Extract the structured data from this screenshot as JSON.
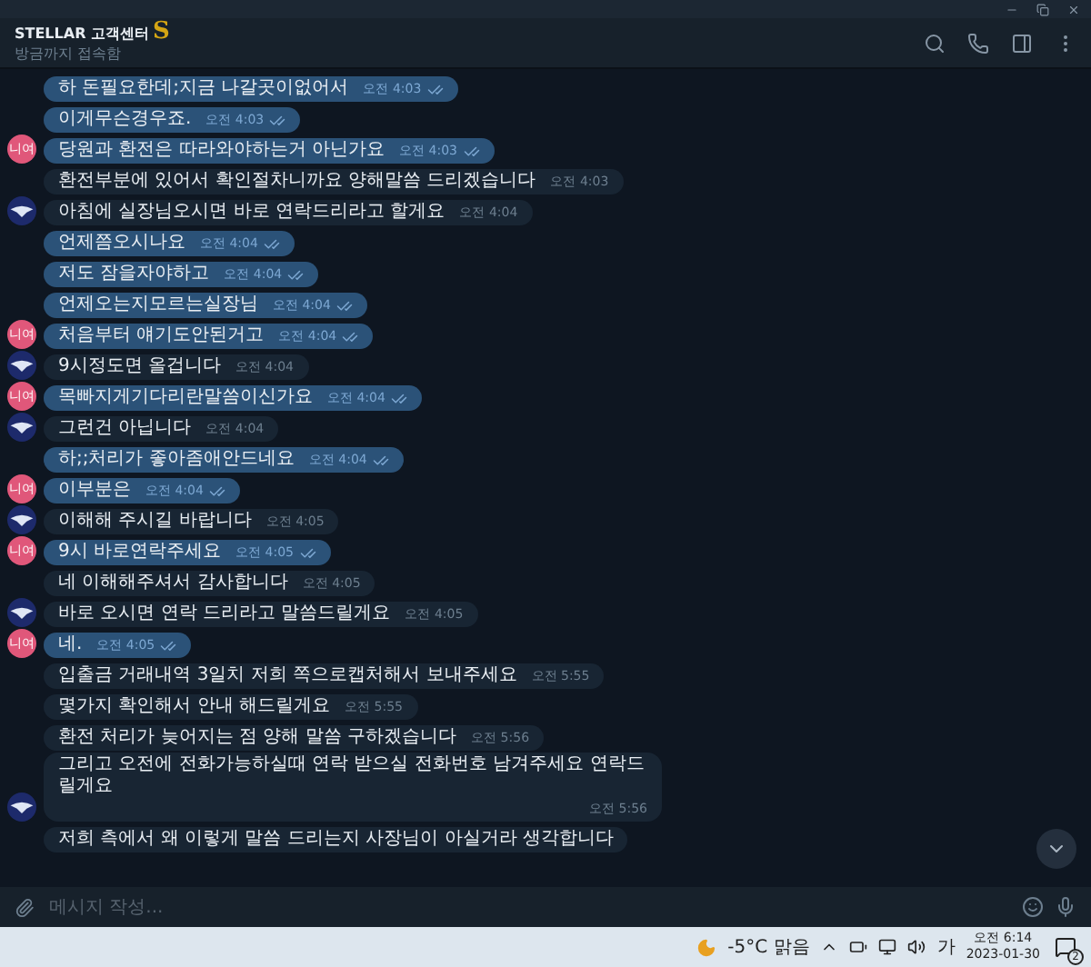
{
  "window": {
    "title": "STELLAR 고객센터",
    "title_badge": "S",
    "status": "방금까지 접속함"
  },
  "messages": [
    {
      "kind": "out",
      "text": "하 돈필요한데;지금 나갈곳이없어서",
      "time": "오전 4:03"
    },
    {
      "kind": "out",
      "text": "이게무슨경우죠.",
      "time": "오전 4:03"
    },
    {
      "kind": "out",
      "text": "당원과 환전은 따라와야하는거 아닌가요",
      "time": "오전 4:03",
      "avatar_text": "니여"
    },
    {
      "kind": "in",
      "text": "환전부분에 있어서 확인절차니까요 양해말씀 드리겠습니다",
      "time": "오전 4:03",
      "avatar": false
    },
    {
      "kind": "in",
      "text": "아침에 실장님오시면 바로 연락드리라고 할게요",
      "time": "오전 4:04",
      "avatar": true
    },
    {
      "kind": "out",
      "text": "언제쯤오시나요",
      "time": "오전 4:04"
    },
    {
      "kind": "out",
      "text": "저도 잠을자야하고",
      "time": "오전 4:04"
    },
    {
      "kind": "out",
      "text": "언제오는지모르는실장님",
      "time": "오전 4:04"
    },
    {
      "kind": "out",
      "text": "처음부터 얘기도안된거고",
      "time": "오전 4:04",
      "avatar_text": "니여"
    },
    {
      "kind": "in",
      "text": "9시정도면 올겁니다",
      "time": "오전 4:04",
      "avatar": true
    },
    {
      "kind": "out",
      "text": "목빠지게기다리란말씀이신가요",
      "time": "오전 4:04",
      "avatar_text": "니여"
    },
    {
      "kind": "in",
      "text": "그런건 아닙니다",
      "time": "오전 4:04",
      "avatar": true
    },
    {
      "kind": "out",
      "text": "하;;처리가 좋아좀애안드네요",
      "time": "오전 4:04"
    },
    {
      "kind": "out",
      "text": "이부분은",
      "time": "오전 4:04",
      "avatar_text": "니여"
    },
    {
      "kind": "in",
      "text": "이해해 주시길 바랍니다",
      "time": "오전 4:05",
      "avatar": true
    },
    {
      "kind": "out",
      "text": "9시 바로연락주세요",
      "time": "오전 4:05",
      "avatar_text": "니여"
    },
    {
      "kind": "in",
      "text": "네 이해해주셔서 감사합니다",
      "time": "오전 4:05",
      "avatar": false
    },
    {
      "kind": "in",
      "text": "바로 오시면 연락 드리라고 말씀드릴게요",
      "time": "오전 4:05",
      "avatar": true
    },
    {
      "kind": "out",
      "text": "네.",
      "time": "오전 4:05",
      "avatar_text": "니여"
    },
    {
      "kind": "in",
      "text": "입출금 거래내역 3일치 저희 쪽으로캡처해서 보내주세요",
      "time": "오전 5:55",
      "avatar": false
    },
    {
      "kind": "in",
      "text": "몇가지 확인해서 안내 해드릴게요",
      "time": "오전 5:55",
      "avatar": false
    },
    {
      "kind": "in",
      "text": "환전 처리가 늦어지는 점 양해 말씀 구하겠습니다",
      "time": "오전 5:56",
      "avatar": false
    },
    {
      "kind": "in",
      "text": "그리고 오전에 전화가능하실때 연락 받으실 전화번호 남겨주세요 연락드릴게요",
      "time": "오전 5:56",
      "avatar": true
    },
    {
      "kind": "in",
      "text": "저희 측에서 왜 이렇게 말씀 드리는지 사장님이 아실거라 생각합니다",
      "avatar": false
    }
  ],
  "composer": {
    "placeholder": "메시지 작성..."
  },
  "taskbar": {
    "weather": "-5°C 맑음",
    "ime": "가",
    "time": "오전 6:14",
    "date": "2023-01-30",
    "notifications": "2"
  }
}
